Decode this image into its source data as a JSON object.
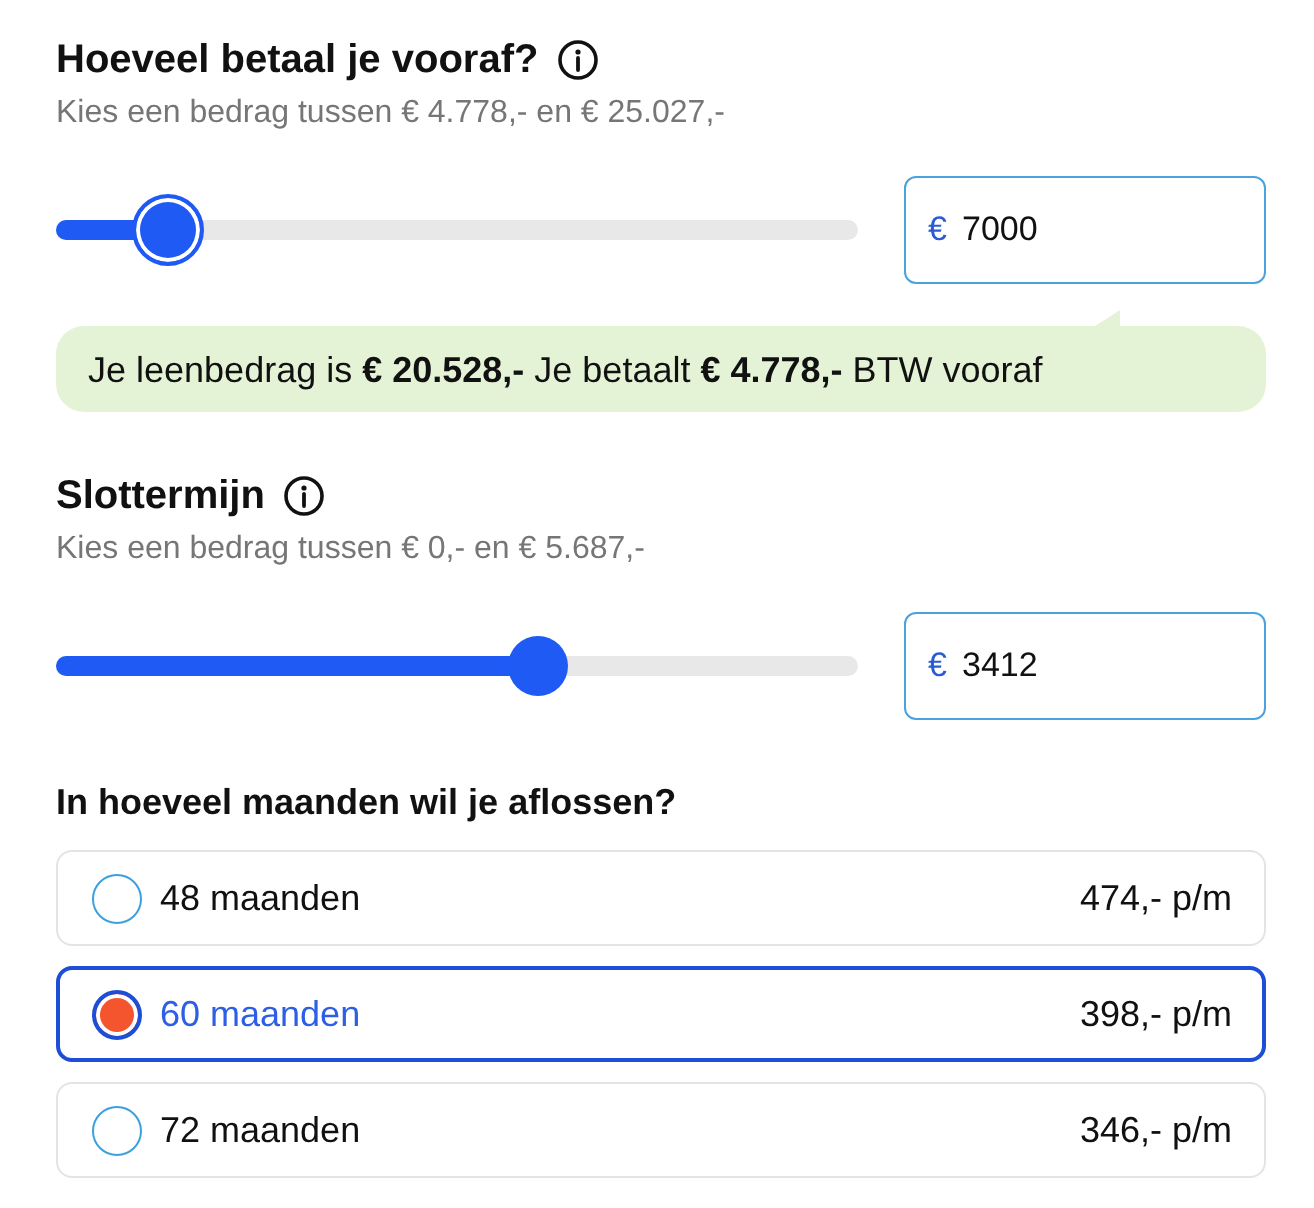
{
  "sections": [
    {
      "title": "Hoeveel betaal je vooraf?",
      "hint": "Kies een bedrag tussen € 4.778,- en € 25.027,-",
      "slider": {
        "level": 0.14,
        "focused": true
      },
      "amount": {
        "currency": "€",
        "value": "7000"
      },
      "message": "Je leenbedrag is **€ 20.528,-** Je betaalt **€ 4.778,-** BTW vooraf"
    },
    {
      "title": "Slottermijn",
      "hint": "Kies een bedrag tussen € 0,- en € 5.687,-",
      "slider": {
        "level": 0.6,
        "focused": false
      },
      "amount": {
        "currency": "€",
        "value": "3412"
      }
    }
  ],
  "term": {
    "question": "In hoeveel maanden wil je aflossen?",
    "options": [
      {
        "label": "48 maanden",
        "price": "474,- p/m",
        "selected": false
      },
      {
        "label": "60 maanden",
        "price": "398,- p/m",
        "selected": true
      },
      {
        "label": "72 maanden",
        "price": "346,- p/m",
        "selected": false
      }
    ]
  }
}
